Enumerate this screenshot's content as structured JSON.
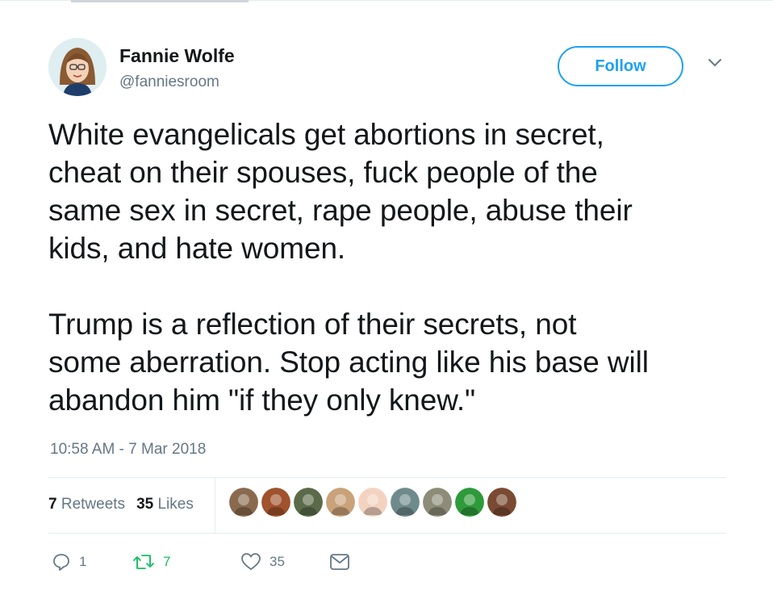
{
  "author": {
    "name": "Fannie Wolfe",
    "handle": "@fanniesroom"
  },
  "follow_label": "Follow",
  "tweet": {
    "text": "White evangelicals get abortions in secret,\ncheat on their spouses, fuck people of the\nsame sex in secret, rape people, abuse their\nkids, and hate women.\n\nTrump is a reflection of their secrets, not\nsome aberration. Stop acting like his base will\nabandon him \"if they only knew.\"",
    "timestamp": "10:58 AM - 7 Mar 2018"
  },
  "stats": {
    "retweets_count": "7",
    "retweets_label": "Retweets",
    "likes_count": "35",
    "likes_label": "Likes"
  },
  "likers": [
    {
      "name": "liker-1",
      "color": "#8a6a4e"
    },
    {
      "name": "liker-2",
      "color": "#a0522d"
    },
    {
      "name": "liker-3",
      "color": "#5b6b4a"
    },
    {
      "name": "liker-4",
      "color": "#c9a27a"
    },
    {
      "name": "liker-5",
      "color": "#f3d3c0"
    },
    {
      "name": "liker-6",
      "color": "#6f8a8c"
    },
    {
      "name": "liker-7",
      "color": "#8c8c78"
    },
    {
      "name": "liker-8",
      "color": "#2e9a3a"
    },
    {
      "name": "liker-9",
      "color": "#7a4a32"
    }
  ],
  "actions": {
    "reply_count": "1",
    "retweet_count": "7",
    "like_count": "35"
  },
  "colors": {
    "accent": "#1da1f2",
    "muted": "#657786",
    "retweet_green": "#17bf63",
    "text": "#14171a",
    "border": "#e6ecf0"
  },
  "icons": [
    "chevron-down-icon",
    "reply-icon",
    "retweet-icon",
    "heart-icon",
    "direct-message-icon"
  ]
}
